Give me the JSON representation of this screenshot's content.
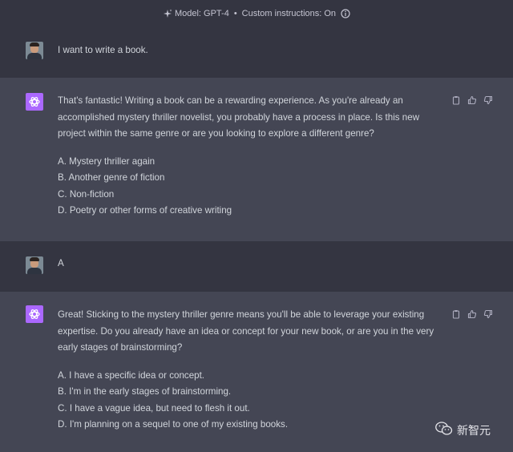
{
  "topbar": {
    "model_label": "Model: GPT-4",
    "separator": "•",
    "custom_instructions": "Custom instructions: On",
    "icons": [
      "sparkle-icon",
      "info-icon"
    ]
  },
  "conversation": [
    {
      "role": "user",
      "text": "I want to write a book."
    },
    {
      "role": "assistant",
      "text": "That's fantastic! Writing a book can be a rewarding experience. As you're already an accomplished mystery thriller novelist, you probably have a process in place. Is this new project within the same genre or are you looking to explore a different genre?",
      "options": [
        "A. Mystery thriller again",
        "B. Another genre of fiction",
        "C. Non-fiction",
        "D. Poetry or other forms of creative writing"
      ]
    },
    {
      "role": "user",
      "text": "A"
    },
    {
      "role": "assistant",
      "text": "Great! Sticking to the mystery thriller genre means you'll be able to leverage your existing expertise. Do you already have an idea or concept for your new book, or are you in the very early stages of brainstorming?",
      "options": [
        "A. I have a specific idea or concept.",
        "B. I'm in the early stages of brainstorming.",
        "C. I have a vague idea, but need to flesh it out.",
        "D. I'm planning on a sequel to one of my existing books."
      ]
    }
  ],
  "message_actions": [
    "copy-icon",
    "thumbs-up-icon",
    "thumbs-down-icon"
  ],
  "watermark": {
    "text": "新智元",
    "icon": "wechat-icon"
  },
  "colors": {
    "user_bg": "#343541",
    "assistant_bg": "#444654",
    "gpt_avatar": "#ab68ff",
    "text": "#d1d5db"
  }
}
